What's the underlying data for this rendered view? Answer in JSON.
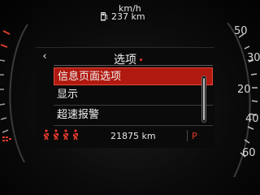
{
  "top": {
    "speed_unit": "km/h",
    "range_value": "237 km",
    "range_icon": "fuel-pump-icon"
  },
  "screen": {
    "title": "选项",
    "back_icon": "chevron-left-icon",
    "menu": [
      {
        "label": "信息页面选项",
        "selected": true
      },
      {
        "label": "显示",
        "selected": false
      },
      {
        "label": "超速报警",
        "selected": false
      }
    ]
  },
  "status": {
    "odometer": "21875 km",
    "gear": "P",
    "warning_icon": "seatbelt-warning-icon",
    "warning_count": 4
  },
  "right_gauge": {
    "tick_labels": [
      "50",
      "30",
      "20",
      "40",
      "60"
    ]
  },
  "colors": {
    "selection_bg": "#b0190f",
    "accent_red": "#e23b2e",
    "text": "#f2f2f2"
  }
}
